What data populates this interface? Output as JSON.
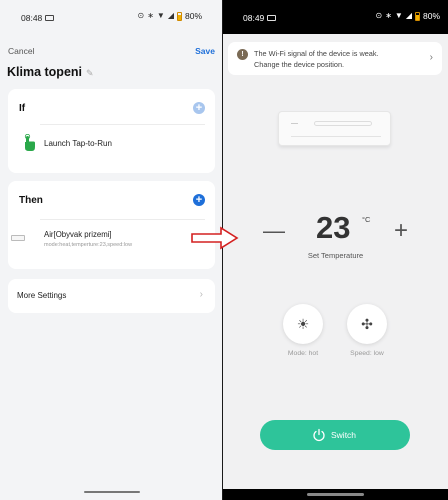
{
  "left": {
    "status": {
      "time": "08:48",
      "battery": "80%"
    },
    "cancel": "Cancel",
    "save": "Save",
    "title": "Klima topeni",
    "if_card": {
      "heading": "If",
      "action": "Launch Tap-to-Run"
    },
    "then_card": {
      "heading": "Then",
      "device": "Air[Obyvak prizemi]",
      "detail": "mode:heat,temperture:23,speed:low"
    },
    "more_settings": "More Settings"
  },
  "right": {
    "status": {
      "time": "08:49",
      "battery": "80%"
    },
    "wifi_warning": {
      "line1": "The Wi-Fi signal of the device is weak.",
      "line2": "Change the device position."
    },
    "temperature": "23",
    "unit": "°C",
    "set_temperature_label": "Set Temperature",
    "mode_label": "Mode: hot",
    "speed_label": "Speed: low",
    "switch_label": "Switch"
  },
  "colors": {
    "accent_blue": "#1e6fd9",
    "switch_green": "#2ec49a",
    "arrow_red": "#d42020"
  }
}
